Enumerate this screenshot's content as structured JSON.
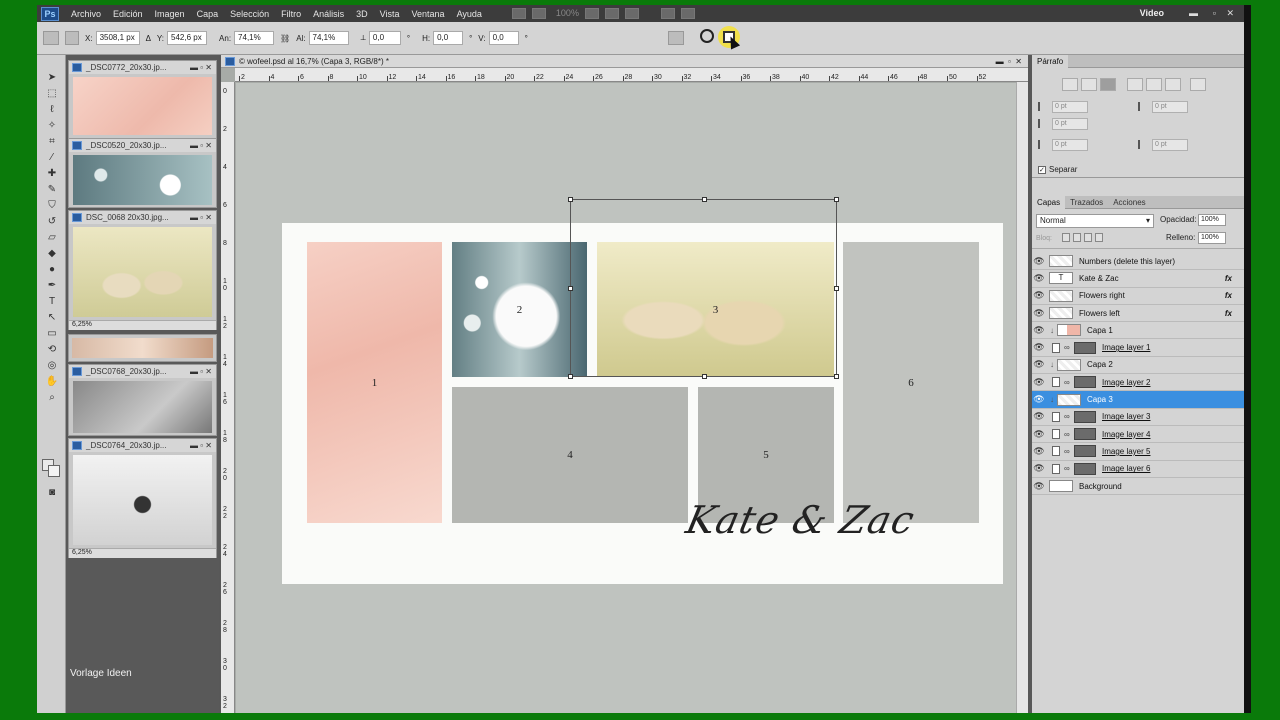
{
  "menubar": {
    "logo": "Ps",
    "items": [
      "Archivo",
      "Edición",
      "Imagen",
      "Capa",
      "Selección",
      "Filtro",
      "Análisis",
      "3D",
      "Vista",
      "Ventana",
      "Ayuda"
    ],
    "workspace": "Video",
    "zoom": "100%"
  },
  "options": {
    "x_label": "X:",
    "x_value": "3508,1 px",
    "y_label": "Y:",
    "y_value": "542,6 px",
    "w_label": "An:",
    "w_value": "74,1%",
    "h_label": "Al:",
    "h_value": "74,1%",
    "angle_label": "⟂",
    "angle_value": "0,0",
    "hskew_label": "H:",
    "hskew_value": "0,0",
    "vskew_label": "V:",
    "vskew_value": "0,0",
    "angle_unit": "°"
  },
  "thumbnails": [
    {
      "title": "_DSC0772_20x30.jp...",
      "color": "#f2c7bc"
    },
    {
      "title": "_DSC0520_20x30.jp...",
      "color": "#8aa3a6"
    },
    {
      "title": "DSC_0068 20x30.jpg...",
      "color": "#d9d2a5",
      "zoom": "6,25%"
    },
    {
      "title": "_DSC0768_20x30.jp...",
      "color": "#7a7a7a"
    },
    {
      "title": "_DSC0764_20x30.jp...",
      "color": "#dcdcdc",
      "zoom": "6,25%"
    }
  ],
  "overlay_text": "Vorlage Ideen",
  "canvas": {
    "title": "© wofeel.psd al 16,7% (Capa 3, RGB/8*) *",
    "ruler_top": [
      "2",
      "4",
      "6",
      "8",
      "10",
      "12",
      "14",
      "16",
      "18",
      "20",
      "22",
      "24",
      "26",
      "28",
      "30",
      "32",
      "34",
      "36",
      "38",
      "40",
      "42",
      "44",
      "46",
      "48",
      "50",
      "52"
    ],
    "ruler_left": [
      "0",
      "2",
      "4",
      "6",
      "8",
      "1 0",
      "1 2",
      "1 4",
      "1 6",
      "1 8",
      "2 0",
      "2 2",
      "2 4",
      "2 6",
      "2 8",
      "3 0",
      "3 2"
    ],
    "slots": [
      "1",
      "2",
      "3",
      "4",
      "5",
      "6"
    ],
    "script_text": "Kate & Zac"
  },
  "paragraph": {
    "tab": "Párrafo",
    "fields": [
      "0 pt",
      "0 pt",
      "0 pt",
      "0 pt",
      "0 pt"
    ],
    "separar": "Separar"
  },
  "layers_panel": {
    "tabs": [
      "Capas",
      "Trazados",
      "Acciones"
    ],
    "blend": "Normal",
    "opacity_label": "Opacidad:",
    "opacity": "100%",
    "fill_label": "Relleno:",
    "fill": "100%",
    "lock_label": "Bloq:",
    "layers": [
      {
        "name": "Numbers (delete this layer)",
        "kind": "plain"
      },
      {
        "name": "Kate  & Zac",
        "kind": "text",
        "fx": "fx"
      },
      {
        "name": "Flowers right",
        "kind": "plain",
        "fx": "fx"
      },
      {
        "name": "Flowers left",
        "kind": "plain",
        "fx": "fx"
      },
      {
        "name": "Capa 1",
        "kind": "clip"
      },
      {
        "name": "Image layer 1",
        "kind": "mask"
      },
      {
        "name": "Capa 2",
        "kind": "clip"
      },
      {
        "name": "Image layer 2",
        "kind": "mask"
      },
      {
        "name": "Capa 3",
        "kind": "clip",
        "selected": true
      },
      {
        "name": "Image layer 3",
        "kind": "mask"
      },
      {
        "name": "Image layer 4",
        "kind": "mask"
      },
      {
        "name": "Image layer 5",
        "kind": "mask"
      },
      {
        "name": "Image layer 6",
        "kind": "mask"
      },
      {
        "name": "Background",
        "kind": "bg"
      }
    ],
    "text_glyph": "T"
  }
}
